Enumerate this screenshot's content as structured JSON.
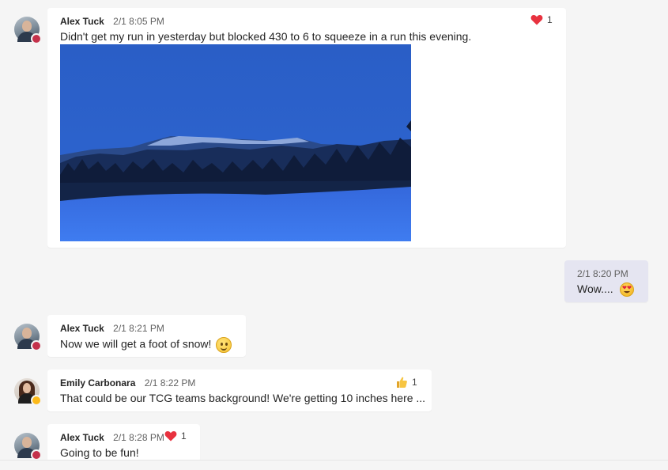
{
  "messages": [
    {
      "author": "Alex Tuck",
      "time": "2/1 8:05 PM",
      "text": "Didn't get my run in yesterday but blocked 430 to 6 to squeeze in a run this evening.",
      "reaction": {
        "icon": "heart-icon",
        "count": "1"
      },
      "has_image": true
    },
    {
      "author": "",
      "time": "2/1 8:20 PM",
      "text": "Wow....",
      "emoji": "heart-eyes-emoji-icon",
      "self": true
    },
    {
      "author": "Alex Tuck",
      "time": "2/1 8:21 PM",
      "text": "Now we will get a foot of snow!",
      "emoji": "smiley-emoji-icon"
    },
    {
      "author": "Emily Carbonara",
      "time": "2/1 8:22 PM",
      "text": "That could be our TCG teams background! We're getting 10 inches here ...",
      "reaction": {
        "icon": "thumbs-up-icon",
        "count": "1"
      }
    },
    {
      "author": "Alex Tuck",
      "time": "2/1 8:28 PM",
      "text": "Going to be fun!",
      "reaction": {
        "icon": "heart-icon",
        "count": "1"
      }
    }
  ],
  "colors": {
    "background": "#f5f5f5",
    "bubble": "#ffffff",
    "self_bubble": "#e5e5f1",
    "heart": "#e8323f",
    "busy_presence": "#c4314b",
    "away_presence": "#fcb919"
  }
}
